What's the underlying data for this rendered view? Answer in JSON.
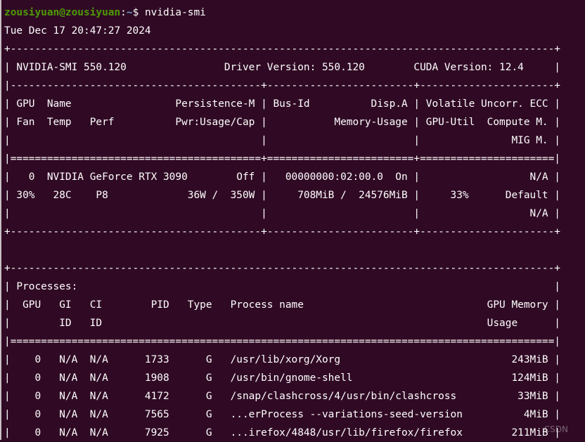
{
  "prompt": {
    "user_host": "zousiyuan@zousiyuan",
    "separator": ":",
    "path": "~",
    "symbol": "$ ",
    "command": "nvidia-smi"
  },
  "output_lines": [
    "Tue Dec 17 20:47:27 2024",
    "+-----------------------------------------------------------------------------------------+",
    "| NVIDIA-SMI 550.120                Driver Version: 550.120        CUDA Version: 12.4     |",
    "|-----------------------------------------+------------------------+----------------------+",
    "| GPU  Name                 Persistence-M | Bus-Id          Disp.A | Volatile Uncorr. ECC |",
    "| Fan  Temp   Perf          Pwr:Usage/Cap |           Memory-Usage | GPU-Util  Compute M. |",
    "|                                         |                        |               MIG M. |",
    "|=========================================+========================+======================|",
    "|   0  NVIDIA GeForce RTX 3090        Off |   00000000:02:00.0  On |                  N/A |",
    "| 30%   28C    P8             36W /  350W |     708MiB /  24576MiB |     33%      Default |",
    "|                                         |                        |                  N/A |",
    "+-----------------------------------------+------------------------+----------------------+",
    "",
    "+-----------------------------------------------------------------------------------------+",
    "| Processes:                                                                              |",
    "|  GPU   GI   CI        PID   Type   Process name                              GPU Memory |",
    "|        ID   ID                                                               Usage      |",
    "|=========================================================================================|",
    "|    0   N/A  N/A      1733      G   /usr/lib/xorg/Xorg                            243MiB |",
    "|    0   N/A  N/A      1908      G   /usr/bin/gnome-shell                          124MiB |",
    "|    0   N/A  N/A      4172      G   /snap/clashcross/4/usr/bin/clashcross          33MiB |",
    "|    0   N/A  N/A      7565      G   ...erProcess --variations-seed-version          4MiB |",
    "|    0   N/A  N/A      7925      G   ...irefox/4848/usr/lib/firefox/firefox        211MiB |"
  ],
  "watermark": "CSDN"
}
